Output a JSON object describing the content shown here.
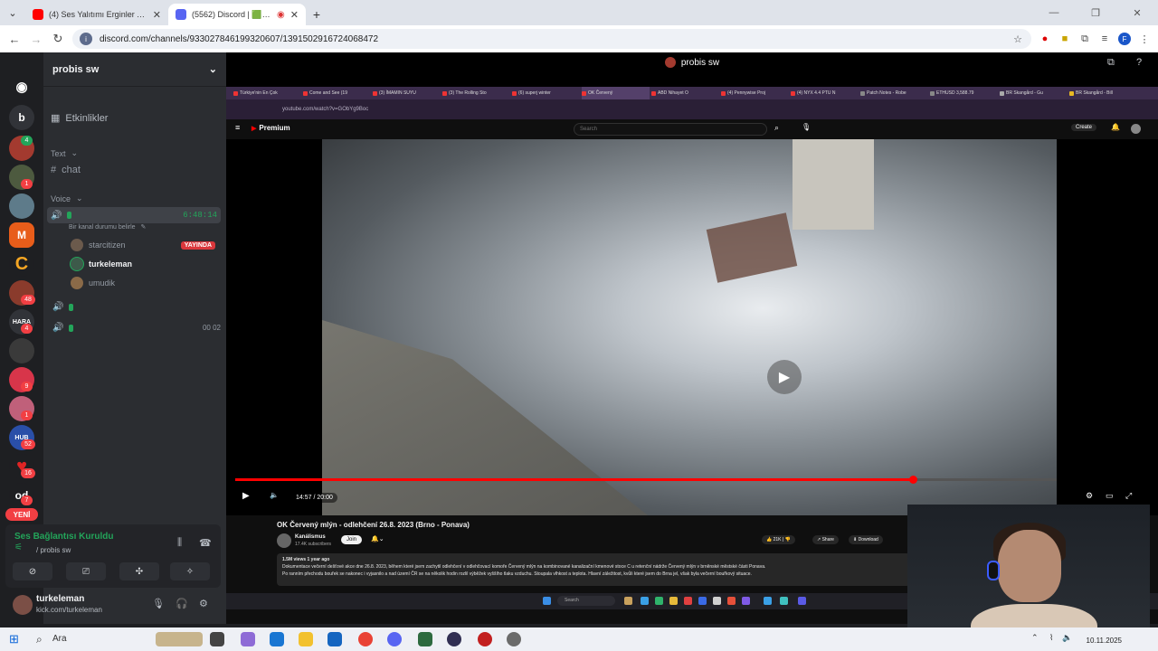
{
  "chrome": {
    "tabs": [
      {
        "title": "(4) Ses Yalıtımı Erginler Ticaret",
        "active": false,
        "favicon_color": "#ff0000"
      },
      {
        "title": "(5562) Discord | 🟩 | probis",
        "active": true,
        "favicon_color": "#5865f2"
      }
    ],
    "new_tab": "+",
    "url": "discord.com/channels/933027846199320607/1391502916724068472"
  },
  "discord": {
    "server_name": "probis sw",
    "events_label": "Etkinlikler",
    "text_category": "Text",
    "text_channel": "chat",
    "voice_category": "Voice",
    "voice_status_hint": "Bir kanal durumu belirle",
    "voice_timer": "6:48:14",
    "voice_users": [
      {
        "name": "starcitizen",
        "live": "YAYINDA"
      },
      {
        "name": "turkeleman",
        "live": ""
      },
      {
        "name": "umudik",
        "live": ""
      }
    ],
    "small_counter": "00  02",
    "guild_letters": [
      "b",
      "od"
    ],
    "guild_badges": [
      "4",
      "1",
      "48",
      "4",
      "9",
      "1",
      "52",
      "16",
      "7"
    ],
    "new_badge": "YENİ",
    "voice_connected": "Ses Bağlantısı Kuruldu",
    "voice_connected_sub": "/ probis sw",
    "user_name": "turkeleman",
    "user_status": "kick.com/turkeleman",
    "stream_title": "probis sw"
  },
  "shared_screen": {
    "inner_url": "youtube.com/watch?v=GObYg9Boc",
    "inner_tabs": [
      "Türkiye'nin En Çok",
      "Come and See (19",
      "(3) İMAMIN SUYU",
      "(3) The Rolling Sto",
      "(6) superj winter",
      "OK Červený",
      "ABD Nihayet O",
      "(4) Pennywise Proj",
      "(4) NYX 4.4 PTU N",
      "Patch Notes - Robe",
      "ETHUSD 3,588.79",
      "BR Skangård - Gu",
      "BR Skangård - Bill"
    ],
    "yt_logo": "Premium",
    "yt_search": "Search",
    "yt_create": "Create",
    "time": "14:57 / 20:00",
    "progress": 0.825,
    "title": "OK Červený mlýn - odlehčení 26.8. 2023 (Brno - Ponava)",
    "channel": "Kanálismus",
    "subscribers": "17.4K subscribers",
    "join": "Join",
    "likes": "21K",
    "share": "Share",
    "download": "Download",
    "views": "1.5M views  1 year ago",
    "desc_line1": "Dokumentace večerní dešťové akce dne 26.8. 2023, během které jsem zachytil odlehčení v odlehčovací komoře Červený mlýn na kombinované kanalizační kmenové stoce C u retenční nádrže Červený mlýn v brněnské městské části Ponava.",
    "desc_line2": "Po ranním přechodu bouřek se nakonec i vyjasnilo a nad území ČR se na několik hodin rozlil výběžek vyššího tlaku vzduchu. Stoupala vlhkost a teplota. Hlavní záležitost, kvůli které jsem do Brna jel, však byla večerní bouřkový situace.",
    "inner_search": "Search"
  },
  "taskbar": {
    "search": "Ara",
    "date": "10.11.2025"
  }
}
